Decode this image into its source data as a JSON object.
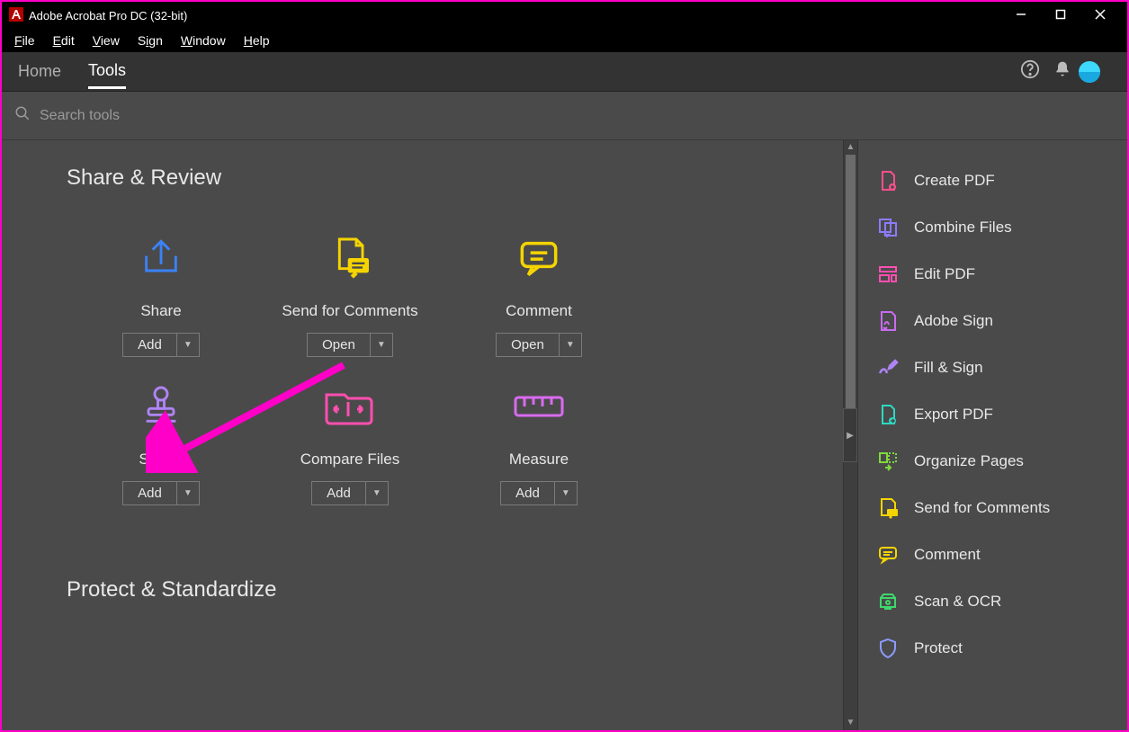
{
  "window": {
    "title": "Adobe Acrobat Pro DC (32-bit)"
  },
  "menu": {
    "items": [
      "File",
      "Edit",
      "View",
      "Sign",
      "Window",
      "Help"
    ]
  },
  "tabs": {
    "home": "Home",
    "tools": "Tools"
  },
  "search": {
    "placeholder": "Search tools"
  },
  "sections": {
    "share_review": "Share & Review",
    "protect_standardize": "Protect & Standardize"
  },
  "tools": {
    "share": {
      "label": "Share",
      "action": "Add"
    },
    "sendcom": {
      "label": "Send for Comments",
      "action": "Open"
    },
    "comment": {
      "label": "Comment",
      "action": "Open"
    },
    "stamp": {
      "label": "Stamp",
      "action": "Add"
    },
    "compare": {
      "label": "Compare Files",
      "action": "Add"
    },
    "measure": {
      "label": "Measure",
      "action": "Add"
    }
  },
  "rail": {
    "create_pdf": "Create PDF",
    "combine_files": "Combine Files",
    "edit_pdf": "Edit PDF",
    "adobe_sign": "Adobe Sign",
    "fill_sign": "Fill & Sign",
    "export_pdf": "Export PDF",
    "organize_pages": "Organize Pages",
    "send_for_comments": "Send for Comments",
    "comment": "Comment",
    "scan_ocr": "Scan & OCR",
    "protect": "Protect"
  }
}
